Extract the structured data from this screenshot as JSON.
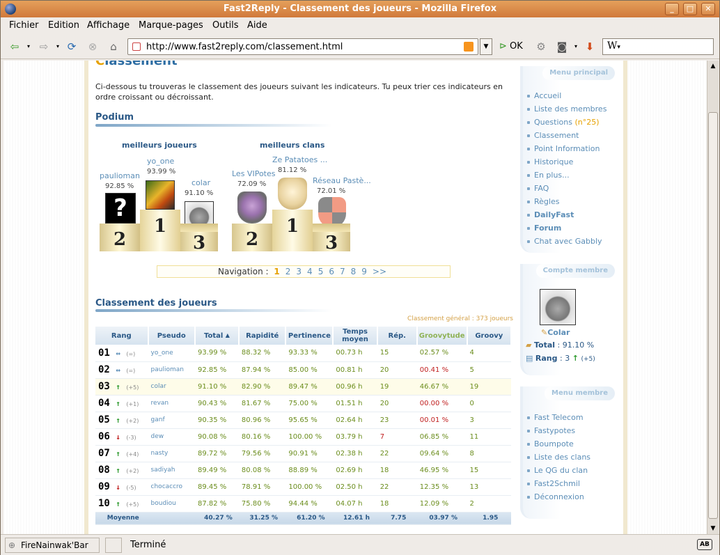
{
  "window": {
    "title": "Fast2Reply - Classement des joueurs - Mozilla Firefox",
    "min": "_",
    "max": "□",
    "close": "✕"
  },
  "menu": [
    "Fichier",
    "Edition",
    "Affichage",
    "Marque-pages",
    "Outils",
    "Aide"
  ],
  "toolbar": {
    "url": "http://www.fast2reply.com/classement.html",
    "go_label": "OK",
    "search_placeholder": "W"
  },
  "page": {
    "title_first": "C",
    "title_rest": "lassement",
    "intro": "Ci-dessous tu trouveras le classement des joueurs suivant les indicateurs. Tu peux trier ces indicateurs en ordre croissant ou décroissant.",
    "podium_title": "Podium",
    "best_players_title": "meilleurs joueurs",
    "best_clans_title": "meilleurs clans",
    "players_podium": [
      {
        "name": "yo_one",
        "pct": "93.99 %",
        "place": "1"
      },
      {
        "name": "paulioman",
        "pct": "92.85 %",
        "place": "2"
      },
      {
        "name": "colar",
        "pct": "91.10 %",
        "place": "3"
      }
    ],
    "clans_podium": [
      {
        "name": "Ze Patatoes ...",
        "pct": "81.12 %",
        "place": "1"
      },
      {
        "name": "Les VIPotes",
        "pct": "72.09 %",
        "place": "2"
      },
      {
        "name": "Réseau Pastè...",
        "pct": "72.01 %",
        "place": "3"
      }
    ],
    "nav_label": "Navigation :",
    "nav_pages": [
      "1",
      "2",
      "3",
      "4",
      "5",
      "6",
      "7",
      "8",
      "9",
      ">>"
    ],
    "ranking_title": "Classement des joueurs",
    "summary": "Classement général : 373 joueurs",
    "columns": [
      "Rang",
      "Pseudo",
      "Total",
      "Rapidité",
      "Pertinence",
      "Temps moyen",
      "Rép.",
      "Groovytude",
      "Groovy"
    ],
    "rows": [
      {
        "rank": "01",
        "arrow": "↔",
        "dir": "eq",
        "delta": "(=)",
        "pseudo": "yo_one",
        "total": "93.99 %",
        "rapidite": "88.32 %",
        "pertinence": "93.33 %",
        "temps": "00.73 h",
        "rep": "15",
        "groovytude": "02.57 %",
        "groovy": "4"
      },
      {
        "rank": "02",
        "arrow": "↔",
        "dir": "eq",
        "delta": "(=)",
        "pseudo": "paulioman",
        "total": "92.85 %",
        "rapidite": "87.94 %",
        "pertinence": "85.00 %",
        "temps": "00.81 h",
        "rep": "20",
        "groovytude": "00.41 %",
        "groovy": "5"
      },
      {
        "rank": "03",
        "arrow": "↑",
        "dir": "up",
        "delta": "(+5)",
        "pseudo": "colar",
        "total": "91.10 %",
        "rapidite": "82.90 %",
        "pertinence": "89.47 %",
        "temps": "00.96 h",
        "rep": "19",
        "groovytude": "46.67 %",
        "groovy": "19"
      },
      {
        "rank": "04",
        "arrow": "↑",
        "dir": "up",
        "delta": "(+1)",
        "pseudo": "revan",
        "total": "90.43 %",
        "rapidite": "81.67 %",
        "pertinence": "75.00 %",
        "temps": "01.51 h",
        "rep": "20",
        "groovytude": "00.00 %",
        "groovy": "0"
      },
      {
        "rank": "05",
        "arrow": "↑",
        "dir": "up",
        "delta": "(+2)",
        "pseudo": "ganf",
        "total": "90.35 %",
        "rapidite": "80.96 %",
        "pertinence": "95.65 %",
        "temps": "02.64 h",
        "rep": "23",
        "groovytude": "00.01 %",
        "groovy": "3"
      },
      {
        "rank": "06",
        "arrow": "↓",
        "dir": "dn",
        "delta": "(-3)",
        "pseudo": "dew",
        "total": "90.08 %",
        "rapidite": "80.16 %",
        "pertinence": "100.00 %",
        "temps": "03.79 h",
        "rep": "7",
        "groovytude": "06.85 %",
        "groovy": "11"
      },
      {
        "rank": "07",
        "arrow": "↑",
        "dir": "up",
        "delta": "(+4)",
        "pseudo": "nasty",
        "total": "89.72 %",
        "rapidite": "79.56 %",
        "pertinence": "90.91 %",
        "temps": "02.38 h",
        "rep": "22",
        "groovytude": "09.64 %",
        "groovy": "8"
      },
      {
        "rank": "08",
        "arrow": "↑",
        "dir": "up",
        "delta": "(+2)",
        "pseudo": "sadiyah",
        "total": "89.49 %",
        "rapidite": "80.08 %",
        "pertinence": "88.89 %",
        "temps": "02.69 h",
        "rep": "18",
        "groovytude": "46.95 %",
        "groovy": "15"
      },
      {
        "rank": "09",
        "arrow": "↓",
        "dir": "dn",
        "delta": "(-5)",
        "pseudo": "chocaccro",
        "total": "89.45 %",
        "rapidite": "78.91 %",
        "pertinence": "100.00 %",
        "temps": "02.50 h",
        "rep": "22",
        "groovytude": "12.35 %",
        "groovy": "13"
      },
      {
        "rank": "10",
        "arrow": "↑",
        "dir": "up",
        "delta": "(+5)",
        "pseudo": "boudiou",
        "total": "87.82 %",
        "rapidite": "75.80 %",
        "pertinence": "94.44 %",
        "temps": "04.07 h",
        "rep": "18",
        "groovytude": "12.09 %",
        "groovy": "2"
      }
    ],
    "average": {
      "label": "Moyenne",
      "total": "40.27 %",
      "rapidite": "31.25 %",
      "pertinence": "61.20 %",
      "temps": "12.61 h",
      "rep": "7.75",
      "groovytude": "03.97 %",
      "groovy": "1.95"
    }
  },
  "sidebar": {
    "menu_principal_title": "Menu principal",
    "menu_principal": [
      "Accueil",
      "Liste des membres",
      "Questions",
      "Classement",
      "Point Information",
      "Historique",
      "En plus...",
      "FAQ",
      "Règles",
      "DailyFast",
      "Forum",
      "Chat avec Gabbly"
    ],
    "questions_count": "(n°25)",
    "compte_title": "Compte membre",
    "username": "Colar",
    "total_label": "Total",
    "total_value": ": 91.10 %",
    "rang_label": "Rang",
    "rang_value": ": 3",
    "rang_delta": "(+5)",
    "menu_membre_title": "Menu membre",
    "menu_membre": [
      "Fast Telecom",
      "Fastypotes",
      "Boumpote",
      "Liste des clans",
      "Le QG du clan",
      "Fast2Schmil",
      "Déconnexion"
    ]
  },
  "status": {
    "extension": "FireNainwak'Bar",
    "text": "Terminé",
    "ab": "AB"
  }
}
